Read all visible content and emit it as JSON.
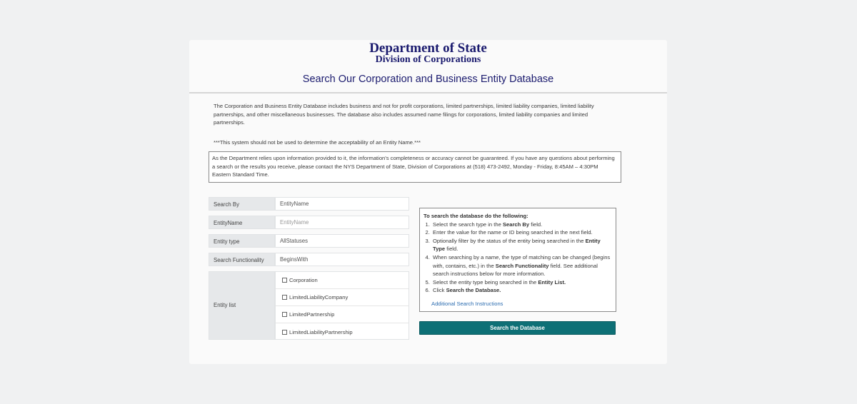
{
  "header": {
    "department": "Department of State",
    "division": "Division of Corporations",
    "title": "Search Our Corporation and Business Entity Database"
  },
  "intro_text": "The Corporation and Business Entity Database includes business and not for profit corporations, limited partnerships, limited liability companies, limited liability partnerships, and other miscellaneous businesses. The database also includes assumed name filings for corporations, limited liability companies and limited partnerships.",
  "warning_text": "***This system should not be used to determine the acceptability of an Entity Name.***",
  "notice_text": "As the Department relies upon information provided to it, the information's completeness or accuracy cannot be guaranteed. If you have any questions about performing a search or the results you receive, please contact the NYS Department of State, Division of Corporations at (518) 473-2492, Monday - Friday, 8:45AM – 4:30PM Eastern Standard Time.",
  "form": {
    "search_by": {
      "label": "Search By",
      "value": "EntityName"
    },
    "entity_name": {
      "label": "EntityName",
      "placeholder": "EntityName"
    },
    "entity_type": {
      "label": "Entity type",
      "value": "AllStatuses"
    },
    "search_functionality": {
      "label": "Search Functionality",
      "value": "BeginsWith"
    },
    "entity_list": {
      "label": "Entity list",
      "options": [
        "Corporation",
        "LimitedLiabilityCompany",
        "LimitedPartnership",
        "LimitedLiabilityPartnership"
      ]
    }
  },
  "help": {
    "heading": "To search the database do the following:",
    "steps": [
      [
        "Select the search type in the ",
        "Search By",
        " field."
      ],
      [
        "Enter the value for the name or ID being searched in the next field.",
        "",
        ""
      ],
      [
        "Optionally filter by the status of the entity being searched in the ",
        "Entity Type",
        " field."
      ],
      [
        "When searching by a name, the type of matching can be changed (begins with, contains, etc.) in the ",
        "Search Functionality",
        " field. See additional search instructions below for more information."
      ],
      [
        "Select the entity type being searched in the ",
        "Entity List.",
        ""
      ],
      [
        "Click ",
        "Search the Database.",
        ""
      ]
    ],
    "link": "Additional Search Instructions"
  },
  "search_button": "Search the Database"
}
